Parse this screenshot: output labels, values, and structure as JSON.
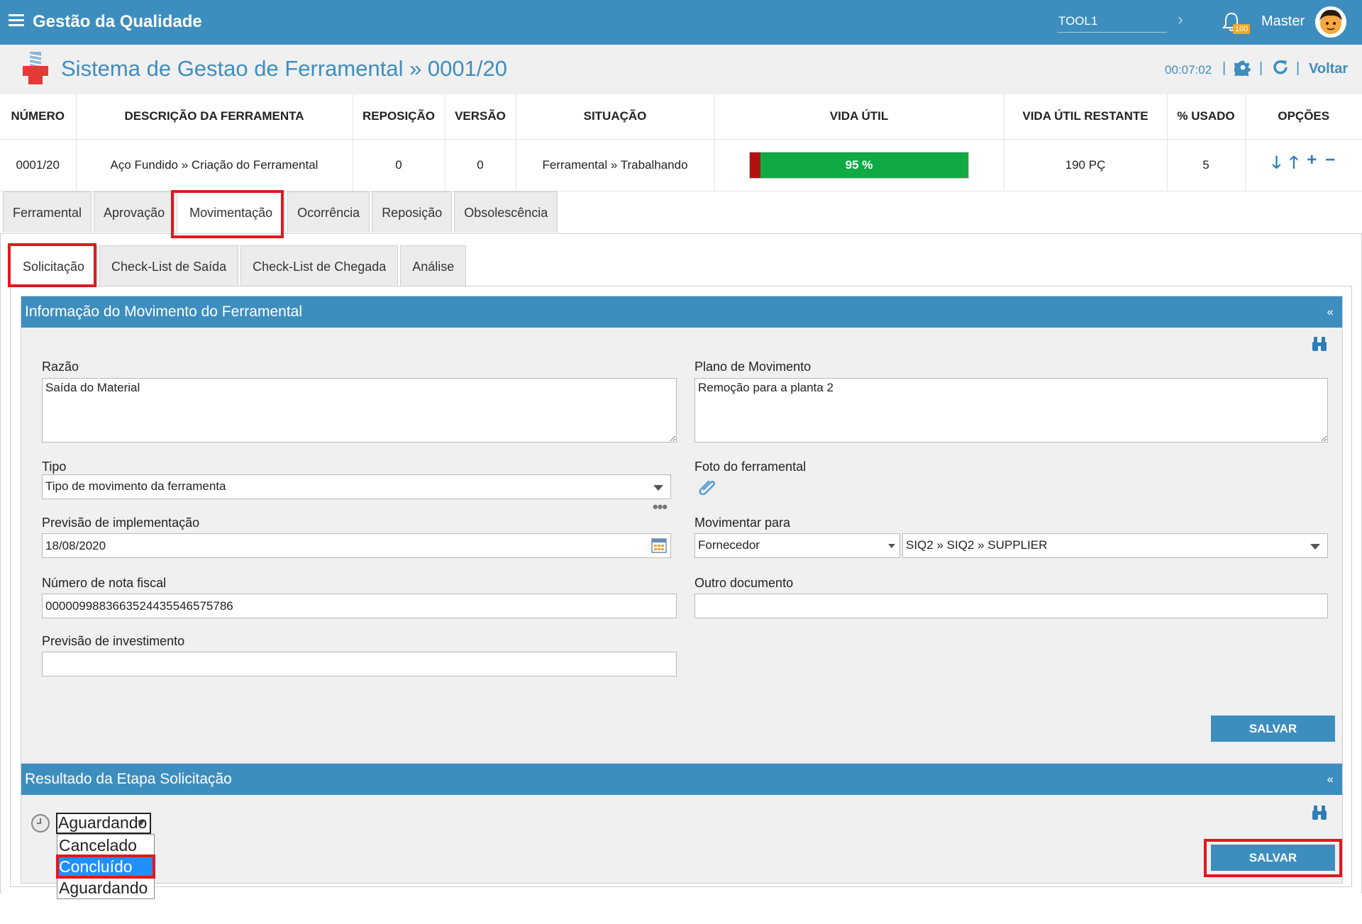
{
  "app": {
    "title": "Gestão da Qualidade",
    "tool_value": "TOOL1",
    "notif_count": "100",
    "user": "Master"
  },
  "header": {
    "title": "Sistema de Gestao de Ferramental » 0001/20",
    "timer": "00:07:02",
    "back_label": "Voltar"
  },
  "summary": {
    "columns": [
      "NÚMERO",
      "DESCRIÇÃO DA FERRAMENTA",
      "REPOSIÇÃO",
      "VERSÃO",
      "SITUAÇÃO",
      "VIDA ÚTIL",
      "VIDA ÚTIL RESTANTE",
      "% USADO",
      "OPÇÕES"
    ],
    "row": {
      "numero": "0001/20",
      "descricao": "Aço Fundido » Criação do Ferramental",
      "reposicao": "0",
      "versao": "0",
      "situacao": "Ferramental » Trabalhando",
      "vida_util_label": "95 %",
      "vida_util_percent": 95,
      "vida_util_restante": "190 PÇ",
      "usado": "5"
    }
  },
  "tabs": [
    "Ferramental",
    "Aprovação",
    "Movimentação",
    "Ocorrência",
    "Reposição",
    "Obsolescência"
  ],
  "subtabs": [
    "Solicitação",
    "Check-List de Saída",
    "Check-List de Chegada",
    "Análise"
  ],
  "section1": {
    "title": "Informação do Movimento do Ferramental",
    "collapse": "«",
    "razao_label": "Razão",
    "razao_value": "Saída do Material",
    "plano_label": "Plano de Movimento",
    "plano_value": "Remoção para a planta 2",
    "tipo_label": "Tipo",
    "tipo_value": "Tipo de movimento da ferramenta",
    "foto_label": "Foto do ferramental",
    "previsao_label": "Previsão de implementação",
    "previsao_value": "18/08/2020",
    "movimentar_label": "Movimentar para",
    "movimentar_type": "Fornecedor",
    "movimentar_target": "SIQ2  »  SIQ2  » SUPPLIER",
    "nota_label": "Número de nota fiscal",
    "nota_value": "0000099883663524435546575786",
    "outro_label": "Outro documento",
    "outro_value": "",
    "invest_label": "Previsão de investimento",
    "invest_value": "",
    "save_label": "SALVAR"
  },
  "section2": {
    "title": "Resultado da Etapa Solicitação",
    "collapse": "«",
    "status_value": "Aguardando",
    "options": [
      "Cancelado",
      "Concluído",
      "Aguardando"
    ],
    "save_label": "SALVAR"
  },
  "colors": {
    "accent": "#3d8ebf",
    "highlight": "#e0191f",
    "life_green": "#10aa44",
    "life_red": "#b01212"
  }
}
